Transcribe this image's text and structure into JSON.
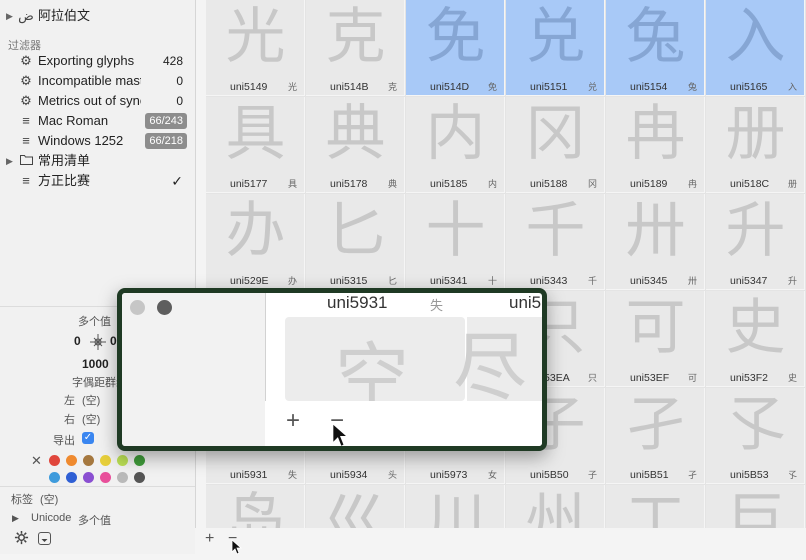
{
  "sidebar": {
    "top_item": {
      "label": "阿拉伯文",
      "icon_glyph": "ض"
    },
    "filters_title": "过滤器",
    "filters": [
      {
        "label": "Exporting glyphs",
        "count": "428",
        "icon": "gear-icon"
      },
      {
        "label": "Incompatible maste…",
        "count": "0",
        "icon": "gear-icon"
      },
      {
        "label": "Metrics out of sync",
        "count": "0",
        "icon": "gear-icon"
      },
      {
        "label": "Mac Roman",
        "count": "66/243",
        "icon": "list-icon"
      },
      {
        "label": "Windows 1252",
        "count": "66/218",
        "icon": "list-icon"
      }
    ],
    "folder": {
      "label": "常用清单",
      "icon": "folder-icon"
    },
    "selected_list": {
      "label": "方正比赛",
      "mark": "✓"
    }
  },
  "inspector": {
    "multi_value": "多个值",
    "metric_left": "0",
    "metric_right": "0",
    "width": "1000",
    "kerning_group": "字偶距群组",
    "left_label": "左",
    "left_value": "(空)",
    "right_label": "右",
    "right_value": "(空)",
    "export_label": "导出",
    "export_checked": "✓",
    "clear_color": "✕",
    "colors_row1": [
      "#e0463c",
      "#ef8a2f",
      "#a5783f",
      "#e7cf3b",
      "#b9dd54",
      "#3f9b3a"
    ],
    "colors_row2": [
      "#3e9bdc",
      "#2f5fd4",
      "#8a4fd1",
      "#e84f9a",
      "#b9b9b9",
      "#555555"
    ],
    "tags_label": "标签",
    "tags_value": "(空)",
    "unicode_label": "Unicode",
    "unicode_value": "多个值"
  },
  "glyphs": [
    {
      "char": "光",
      "name": "uni5149",
      "small": "光",
      "selected": false
    },
    {
      "char": "克",
      "name": "uni514B",
      "small": "克",
      "selected": false
    },
    {
      "char": "免",
      "name": "uni514D",
      "small": "免",
      "selected": true
    },
    {
      "char": "兑",
      "name": "uni5151",
      "small": "兑",
      "selected": true
    },
    {
      "char": "兔",
      "name": "uni5154",
      "small": "兔",
      "selected": true
    },
    {
      "char": "入",
      "name": "uni5165",
      "small": "入",
      "selected": true
    },
    {
      "char": "具",
      "name": "uni5177",
      "small": "具",
      "selected": false
    },
    {
      "char": "典",
      "name": "uni5178",
      "small": "典",
      "selected": false
    },
    {
      "char": "内",
      "name": "uni5185",
      "small": "内",
      "selected": false
    },
    {
      "char": "冈",
      "name": "uni5188",
      "small": "冈",
      "selected": false
    },
    {
      "char": "冉",
      "name": "uni5189",
      "small": "冉",
      "selected": false
    },
    {
      "char": "册",
      "name": "uni518C",
      "small": "册",
      "selected": false
    },
    {
      "char": "办",
      "name": "uni529E",
      "small": "办",
      "selected": false
    },
    {
      "char": "匕",
      "name": "uni5315",
      "small": "匕",
      "selected": false
    },
    {
      "char": "十",
      "name": "uni5341",
      "small": "十",
      "selected": false
    },
    {
      "char": "千",
      "name": "uni5343",
      "small": "千",
      "selected": false
    },
    {
      "char": "卅",
      "name": "uni5345",
      "small": "卅",
      "selected": false
    },
    {
      "char": "升",
      "name": "uni5347",
      "small": "升",
      "selected": false
    },
    {
      "char": "",
      "name": "",
      "small": "",
      "selected": false
    },
    {
      "char": "",
      "name": "",
      "small": "",
      "selected": false
    },
    {
      "char": "",
      "name": "",
      "small": "",
      "selected": false
    },
    {
      "char": "只",
      "name": "uni53EA",
      "small": "只",
      "selected": false
    },
    {
      "char": "可",
      "name": "uni53EF",
      "small": "可",
      "selected": false
    },
    {
      "char": "史",
      "name": "uni53F2",
      "small": "史",
      "selected": false
    },
    {
      "char": "失",
      "name": "uni5931",
      "small": "失",
      "selected": false
    },
    {
      "char": "头",
      "name": "uni5934",
      "small": "头",
      "selected": false
    },
    {
      "char": "女",
      "name": "uni5973",
      "small": "女",
      "selected": false
    },
    {
      "char": "子",
      "name": "uni5B50",
      "small": "子",
      "selected": false
    },
    {
      "char": "孑",
      "name": "uni5B51",
      "small": "孑",
      "selected": false
    },
    {
      "char": "孓",
      "name": "uni5B53",
      "small": "孓",
      "selected": false
    },
    {
      "char": "岛",
      "name": "",
      "small": "",
      "selected": false
    },
    {
      "char": "巛",
      "name": "",
      "small": "",
      "selected": false
    },
    {
      "char": "川",
      "name": "",
      "small": "",
      "selected": false
    },
    {
      "char": "州",
      "name": "",
      "small": "",
      "selected": false
    },
    {
      "char": "工",
      "name": "",
      "small": "",
      "selected": false
    },
    {
      "char": "巨",
      "name": "",
      "small": "",
      "selected": false
    }
  ],
  "popup": {
    "header_name": "uni5931",
    "header_char": "失",
    "header_name2": "uni5",
    "glyph_a": "空",
    "glyph_b": "尽",
    "add_label": "+",
    "remove_label": "−"
  },
  "bottombar": {
    "add_label": "+",
    "remove_label": "−"
  }
}
